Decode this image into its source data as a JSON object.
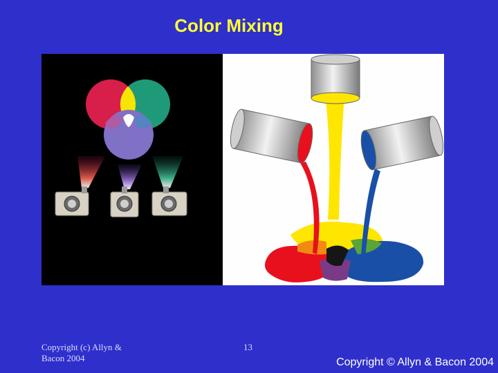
{
  "slide": {
    "title": "Color Mixing",
    "footer_left": "Copyright (c) Allyn & Bacon 2004",
    "page_number": "13",
    "footer_right": "Copyright © Allyn & Bacon 2004"
  },
  "illustrations": {
    "light_mixing": {
      "icon": "additive-light-mixing-illustration",
      "colors": {
        "red": "#d81e4a",
        "green": "#1f9a78",
        "blue": "#8070c6",
        "background": "#000000"
      }
    },
    "paint_mixing": {
      "icon": "subtractive-paint-mixing-illustration",
      "colors": {
        "yellow": "#ffe600",
        "red": "#e8101c",
        "blue": "#1a4fa8",
        "can": "#c8c8c8"
      }
    }
  }
}
